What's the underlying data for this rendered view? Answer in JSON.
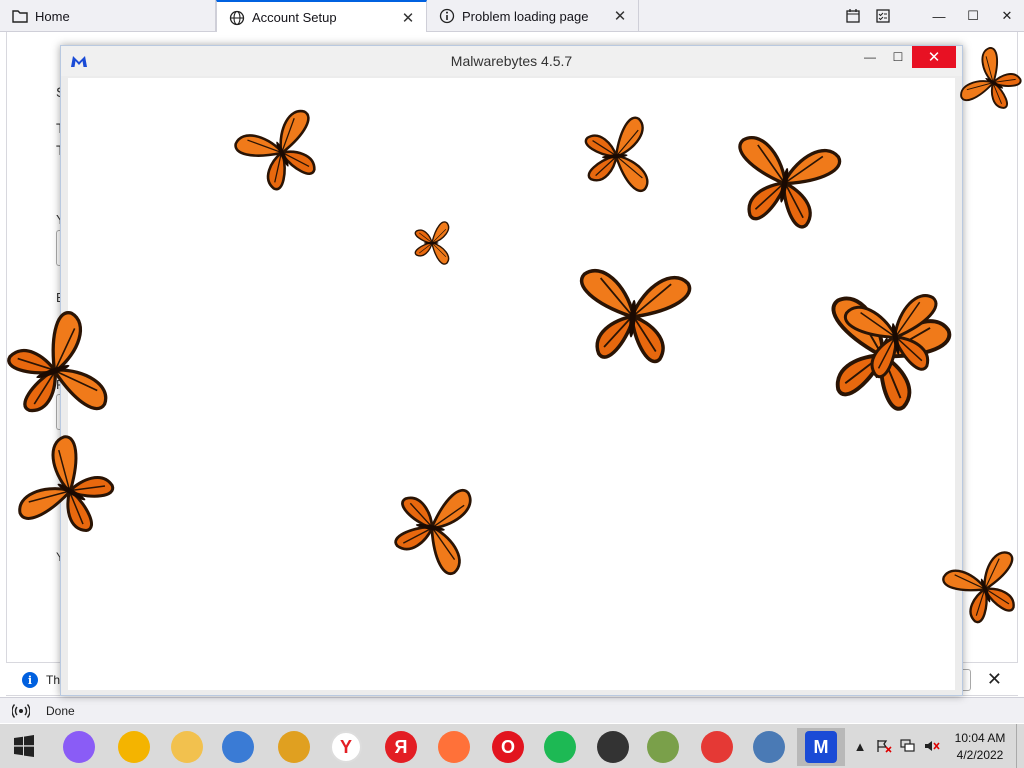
{
  "browser": {
    "tabs": [
      {
        "label": "Home",
        "icon": "folder-icon"
      },
      {
        "label": "Account Setup",
        "icon": "globe-icon"
      },
      {
        "label": "Problem loading page",
        "icon": "info-icon"
      }
    ],
    "toolbar_icons": [
      "calendar-icon",
      "tasks-icon"
    ],
    "accent_color": "#0061e0"
  },
  "background_page": {
    "fragments": [
      "S",
      "T",
      "T",
      "Y",
      "E",
      "F",
      "Y"
    ]
  },
  "notification": {
    "text": "Th"
  },
  "status": {
    "text": "Done"
  },
  "malwarebytes": {
    "title": "Malwarebytes 4.5.7",
    "minimize_label": "—",
    "maximize_label": "☐",
    "close_label": "✕",
    "butterfly_count": 14
  },
  "taskbar": {
    "apps": [
      {
        "name": "alice-icon",
        "color": "#8a5cf6"
      },
      {
        "name": "chrome-canary-icon",
        "color": "#f4b400"
      },
      {
        "name": "file-explorer-icon",
        "color": "#f2c14e"
      },
      {
        "name": "thunderbird-icon",
        "color": "#3a7bd5"
      },
      {
        "name": "megaphone-icon",
        "color": "#e0a020"
      },
      {
        "name": "yandex-browser-icon",
        "color": "#ffffff"
      },
      {
        "name": "yandex-icon",
        "color": "#e31e24"
      },
      {
        "name": "firefox-icon",
        "color": "#ff7139"
      },
      {
        "name": "opera-icon",
        "color": "#e2141f"
      },
      {
        "name": "spotify-icon",
        "color": "#1db954"
      },
      {
        "name": "ccleaner-icon",
        "color": "#333333"
      },
      {
        "name": "network-tool-icon",
        "color": "#7aa04a"
      },
      {
        "name": "flash-tool-icon",
        "color": "#e53935"
      },
      {
        "name": "setup-icon",
        "color": "#4a7ab5"
      },
      {
        "name": "malwarebytes-icon",
        "color": "#1a4bd6"
      }
    ],
    "clock_time": "10:04 AM",
    "clock_date": "4/2/2022"
  }
}
